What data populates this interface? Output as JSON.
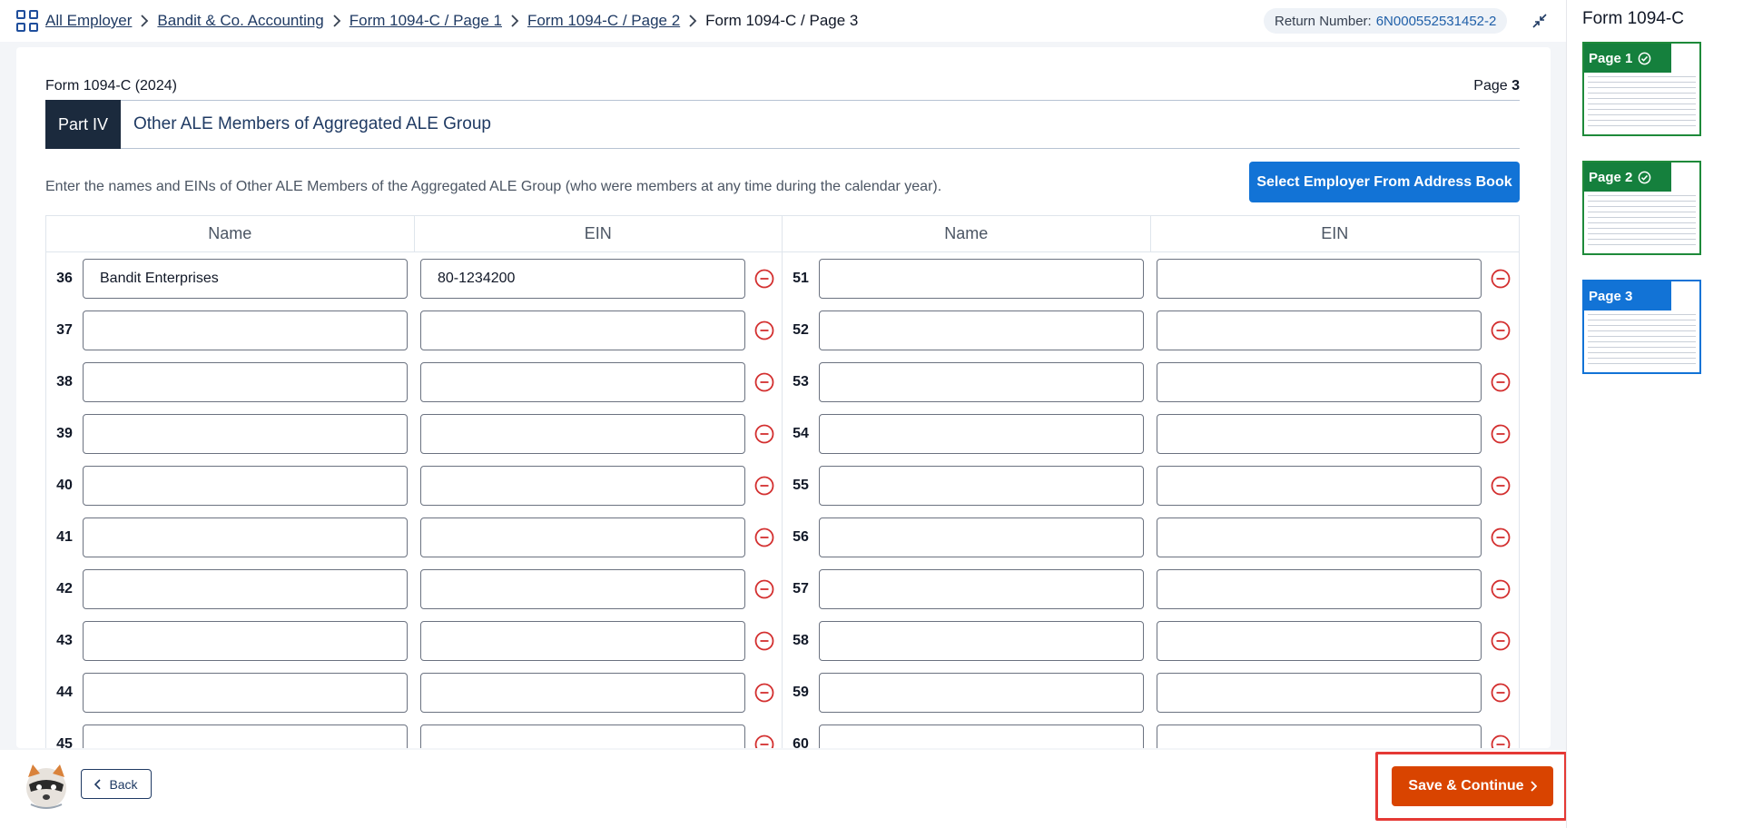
{
  "breadcrumb": {
    "items": [
      {
        "label": "All Employer"
      },
      {
        "label": "Bandit & Co. Accounting"
      },
      {
        "label": "Form 1094-C / Page 1"
      },
      {
        "label": "Form 1094-C / Page 2"
      }
    ],
    "current": "Form 1094-C / Page 3"
  },
  "return_number": {
    "label": "Return Number:",
    "value": "6N000552531452-2"
  },
  "form": {
    "title": "Form 1094-C (2024)",
    "page_label": "Page",
    "page_number": "3",
    "part_tag": "Part IV",
    "part_title": "Other ALE Members of Aggregated ALE Group",
    "instructions": "Enter the names and EINs of Other ALE Members of the Aggregated ALE Group (who were members at any time during the calendar year).",
    "select_button": "Select Employer From Address Book",
    "headers": [
      "Name",
      "EIN",
      "Name",
      "EIN"
    ]
  },
  "rows": [
    {
      "left_num": "36",
      "left_name": "Bandit Enterprises",
      "left_ein": "80-1234200",
      "right_num": "51",
      "right_name": "",
      "right_ein": ""
    },
    {
      "left_num": "37",
      "left_name": "",
      "left_ein": "",
      "right_num": "52",
      "right_name": "",
      "right_ein": ""
    },
    {
      "left_num": "38",
      "left_name": "",
      "left_ein": "",
      "right_num": "53",
      "right_name": "",
      "right_ein": ""
    },
    {
      "left_num": "39",
      "left_name": "",
      "left_ein": "",
      "right_num": "54",
      "right_name": "",
      "right_ein": ""
    },
    {
      "left_num": "40",
      "left_name": "",
      "left_ein": "",
      "right_num": "55",
      "right_name": "",
      "right_ein": ""
    },
    {
      "left_num": "41",
      "left_name": "",
      "left_ein": "",
      "right_num": "56",
      "right_name": "",
      "right_ein": ""
    },
    {
      "left_num": "42",
      "left_name": "",
      "left_ein": "",
      "right_num": "57",
      "right_name": "",
      "right_ein": ""
    },
    {
      "left_num": "43",
      "left_name": "",
      "left_ein": "",
      "right_num": "58",
      "right_name": "",
      "right_ein": ""
    },
    {
      "left_num": "44",
      "left_name": "",
      "left_ein": "",
      "right_num": "59",
      "right_name": "",
      "right_ein": ""
    },
    {
      "left_num": "45",
      "left_name": "",
      "left_ein": "",
      "right_num": "60",
      "right_name": "",
      "right_ein": ""
    }
  ],
  "footer": {
    "back_label": "Back",
    "save_label": "Save & Continue"
  },
  "sidebar": {
    "title": "Form 1094-C",
    "pages": [
      {
        "label": "Page 1",
        "status": "complete"
      },
      {
        "label": "Page 2",
        "status": "complete"
      },
      {
        "label": "Page 3",
        "status": "active"
      }
    ]
  },
  "colors": {
    "primary": "#1273d6",
    "save": "#d94400",
    "complete": "#15803d",
    "remove": "#d32f2f",
    "highlight": "#e53935"
  }
}
